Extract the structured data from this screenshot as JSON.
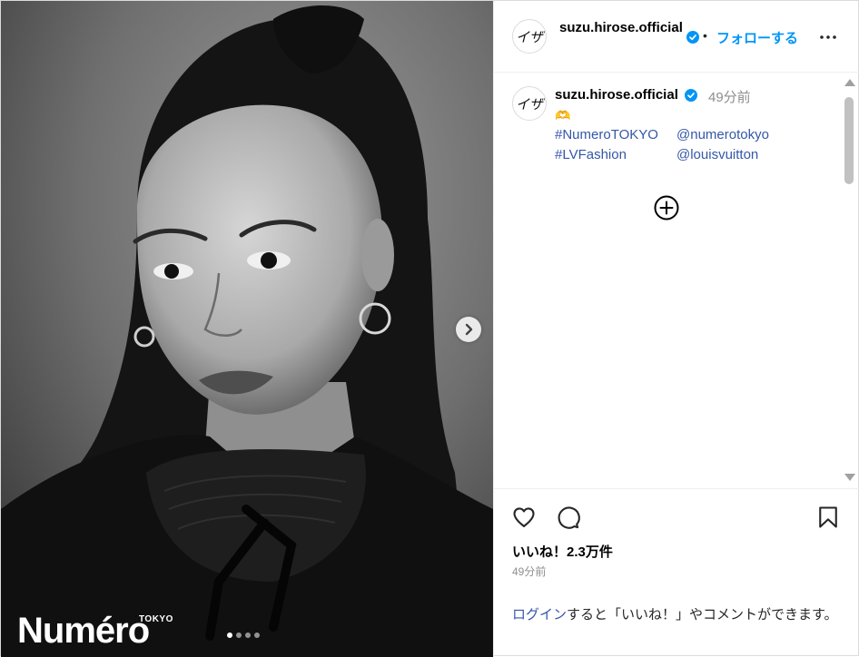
{
  "media": {
    "brand": "Numéro",
    "brand_sub": "TOKYO",
    "carousel_count": 4,
    "carousel_active_index": 0
  },
  "header": {
    "avatar_glyph": "イザ",
    "username": "suzu.hirose.official",
    "separator": "•",
    "follow_label": "フォローする"
  },
  "caption": {
    "username": "suzu.hirose.official",
    "time": "49分前",
    "emoji": "🫶",
    "hashtags": [
      [
        "#NumeroTOKYO",
        "@numerotokyo"
      ],
      [
        "#LVFashion",
        "@louisvuitton"
      ]
    ]
  },
  "actions": {
    "likes": "いいね！2.3万件",
    "time": "49分前",
    "login_link": "ログイン",
    "login_rest": "すると「いいね！」やコメントができます。"
  },
  "colors": {
    "link": "#3557a8",
    "follow": "#0095f6",
    "verified": "#0095f6",
    "muted": "#8e8e8e"
  }
}
